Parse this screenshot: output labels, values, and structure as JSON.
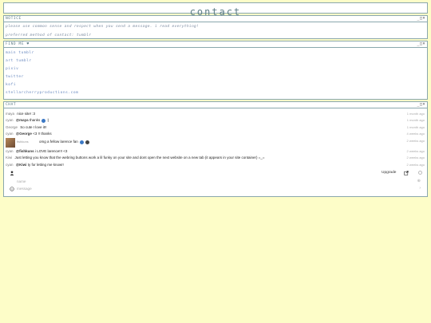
{
  "page": {
    "title": "contact"
  },
  "window_controls": "_□×",
  "notice": {
    "title": "NOTICE",
    "lines": [
      "please use common sense and respect when you send a message. i read everything!",
      "preferred method of contact: tumblr"
    ]
  },
  "findme": {
    "title": "FIND ME ♥",
    "links": [
      "main tumblr",
      "art tumblr",
      "pixiv",
      "twitter",
      "kofi",
      "stellarcherryproductions.com"
    ]
  },
  "chat": {
    "title": "CHAT",
    "messages": [
      {
        "who": "maya",
        "text": "nice site! :3",
        "time": "1 month ago"
      },
      {
        "who": "cyan",
        "mention": "@maya",
        "text": "thanks",
        "time": "1 month ago"
      },
      {
        "who": "George",
        "text": "So cute I love it!!",
        "time": "1 month ago"
      },
      {
        "who": "cyan",
        "mention": "@George",
        "text": "<3 !! thanks",
        "time": "4 weeks ago"
      },
      {
        "who": "fishkuns",
        "text": "omg a fellow larence fan",
        "time": "2 weeks ago"
      },
      {
        "who": "cyan",
        "mention": "@fishkuns",
        "text": "i LOVE larence!!! <3",
        "time": "2 weeks ago"
      },
      {
        "who": "Kiwi",
        "text": "Just letting you know that the webring buttons work a lil funky on your site and dont open the next website on a new tab (it appears in your site container) =_=",
        "time": "2 weeks ago"
      },
      {
        "who": "cyan",
        "mention": "@Kiwi",
        "text": "ty for letting me know!!",
        "time": "2 weeks ago"
      }
    ],
    "toolbar": {
      "upgrade_label": "Upgrade"
    },
    "name_placeholder": "name",
    "message_placeholder": "message",
    "send_glyph": "›",
    "name_glyph": "⊕"
  }
}
